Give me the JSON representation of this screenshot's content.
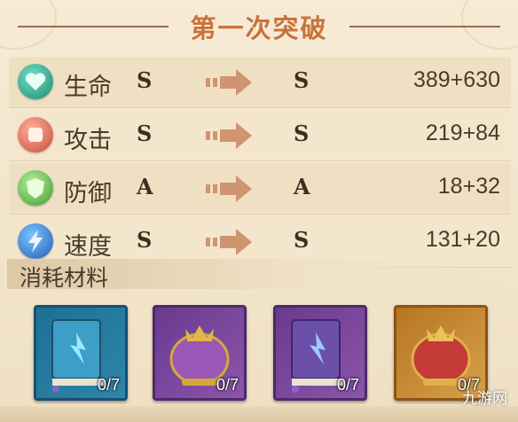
{
  "title": "第一次突破",
  "stats": [
    {
      "label": "生命",
      "before": "S",
      "after": "S",
      "value": "389+630",
      "icon": "heart-icon",
      "color": "#2fae8f"
    },
    {
      "label": "攻击",
      "before": "S",
      "after": "S",
      "value": "219+84",
      "icon": "fist-icon",
      "color": "#e06a58"
    },
    {
      "label": "防御",
      "before": "A",
      "after": "A",
      "value": "18+32",
      "icon": "shield-icon",
      "color": "#5fbf4f"
    },
    {
      "label": "速度",
      "before": "S",
      "after": "S",
      "value": "131+20",
      "icon": "lightning-icon",
      "color": "#2f7fd6"
    }
  ],
  "materials_header": "消耗材料",
  "materials": [
    {
      "count": "0/7",
      "icon": "blue-book-icon"
    },
    {
      "count": "0/7",
      "icon": "purple-crown-icon"
    },
    {
      "count": "0/7",
      "icon": "purple-book-icon"
    },
    {
      "count": "0/7",
      "icon": "red-crown-icon"
    }
  ],
  "watermark": "九游网",
  "colors": {
    "title": "#c8733a",
    "text": "#4a3a2a",
    "arrow": "#cf9470"
  }
}
